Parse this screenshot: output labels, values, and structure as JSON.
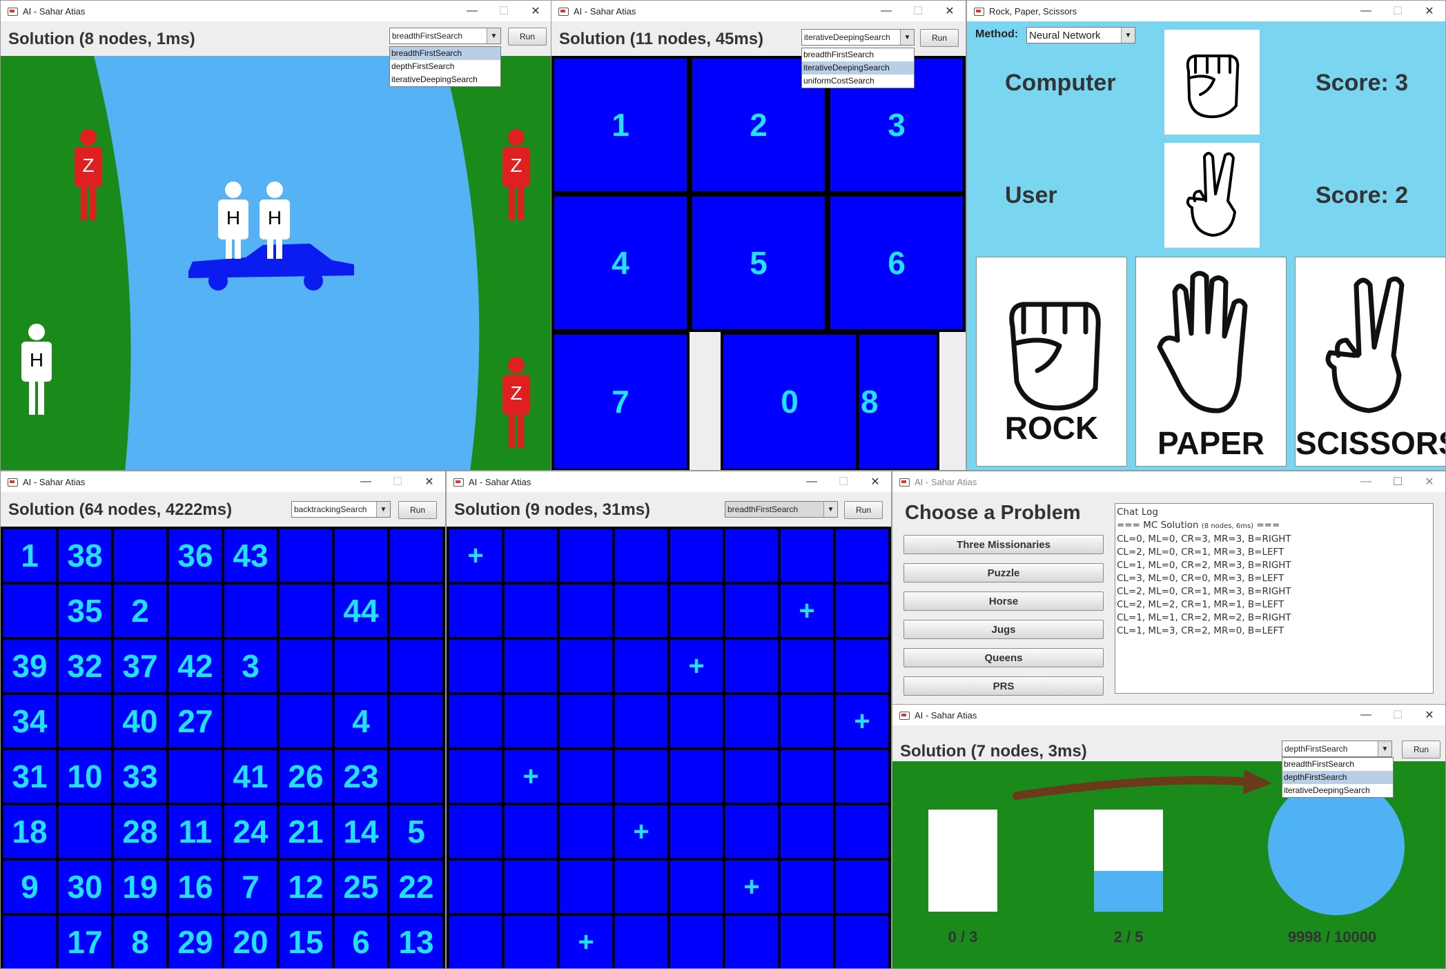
{
  "common": {
    "window_title": "AI - Sahar Atias",
    "run_label": "Run",
    "minimize": "—",
    "maximize": "☐",
    "close": "✕",
    "dropdown_arrow": "▼"
  },
  "mc_window": {
    "solution": "Solution (8 nodes, 1ms)",
    "selected_method": "breadthFirstSearch",
    "options": [
      "breadthFirstSearch",
      "depthFirstSearch",
      "iterativeDeepingSearch"
    ],
    "figure_letters": {
      "zombie": "Z",
      "human": "H"
    },
    "colors": {
      "river": "#55b2f5",
      "bank": "#1a8a1a",
      "car": "#0b1cf0",
      "zombie": "#e02020",
      "human": "#ffffff"
    }
  },
  "puzzle_window": {
    "solution": "Solution (11 nodes, 45ms)",
    "selected_method": "iterativeDeepingSearch",
    "options": [
      "breadthFirstSearch",
      "iterativeDeepingSearch",
      "uniformCostSearch"
    ],
    "tiles": [
      "1",
      "2",
      "3",
      "4",
      "5",
      "6",
      "7",
      "0",
      "8"
    ]
  },
  "rps_window": {
    "title": "Rock, Paper, Scissors",
    "method_label": "Method:",
    "method_value": "Neural Network",
    "computer_label": "Computer",
    "user_label": "User",
    "computer_score": "Score: 3",
    "user_score": "Score: 2",
    "cards": [
      "ROCK",
      "PAPER",
      "SCISSORS"
    ],
    "bg_color": "#7ad6f0"
  },
  "horse_window": {
    "solution": "Solution (64 nodes, 4222ms)",
    "selected_method": "backtrackingSearch",
    "grid": [
      [
        "1",
        "38",
        "",
        "36",
        "43",
        "",
        "",
        ""
      ],
      [
        "",
        "35",
        "2",
        "",
        "",
        "",
        "44",
        ""
      ],
      [
        "39",
        "32",
        "37",
        "42",
        "3",
        "",
        "",
        ""
      ],
      [
        "34",
        "",
        "40",
        "27",
        "",
        "",
        "4",
        ""
      ],
      [
        "31",
        "10",
        "33",
        "",
        "41",
        "26",
        "23",
        ""
      ],
      [
        "18",
        "",
        "28",
        "11",
        "24",
        "21",
        "14",
        "5"
      ],
      [
        "9",
        "30",
        "19",
        "16",
        "7",
        "12",
        "25",
        "22"
      ],
      [
        "",
        "17",
        "8",
        "29",
        "20",
        "15",
        "6",
        "13"
      ]
    ]
  },
  "queens_window": {
    "solution": "Solution (9 nodes, 31ms)",
    "selected_method": "breadthFirstSearch",
    "queen_symbol": "+",
    "queen_columns": [
      0,
      6,
      4,
      7,
      1,
      3,
      5,
      2
    ]
  },
  "chooser_window": {
    "heading": "Choose a Problem",
    "buttons": [
      "Three Missionaries",
      "Puzzle",
      "Horse",
      "Jugs",
      "Queens",
      "PRS"
    ],
    "log_title": "Chat Log",
    "log_header_pre": "=== MC Solution ",
    "log_header_small": "(8 nodes, 6ms)",
    "log_header_post": " ===",
    "log_lines": [
      "CL=0, ML=0, CR=3, MR=3, B=RIGHT",
      "CL=2, ML=0, CR=1, MR=3, B=LEFT",
      "CL=1, ML=0, CR=2, MR=3, B=RIGHT",
      "CL=3, ML=0, CR=0, MR=3, B=LEFT",
      "CL=2, ML=0, CR=1, MR=3, B=RIGHT",
      "CL=2, ML=2, CR=1, MR=1, B=LEFT",
      "CL=1, ML=1, CR=2, MR=2, B=RIGHT",
      "CL=1, ML=3, CR=2, MR=0, B=LEFT"
    ]
  },
  "jugs_window": {
    "solution": "Solution (7 nodes, 3ms)",
    "selected_method": "depthFirstSearch",
    "options": [
      "breadthFirstSearch",
      "depthFirstSearch",
      "iterativeDeepingSearch"
    ],
    "jug_a_label": "0 / 3",
    "jug_b_label": "2 / 5",
    "pool_label": "9998 / 10000",
    "jug_a_fill": 0,
    "jug_b_fill": 0.4,
    "colors": {
      "ground": "#1a8a1a",
      "water": "#4eb2f5",
      "arrow": "#6b3a1a"
    }
  }
}
